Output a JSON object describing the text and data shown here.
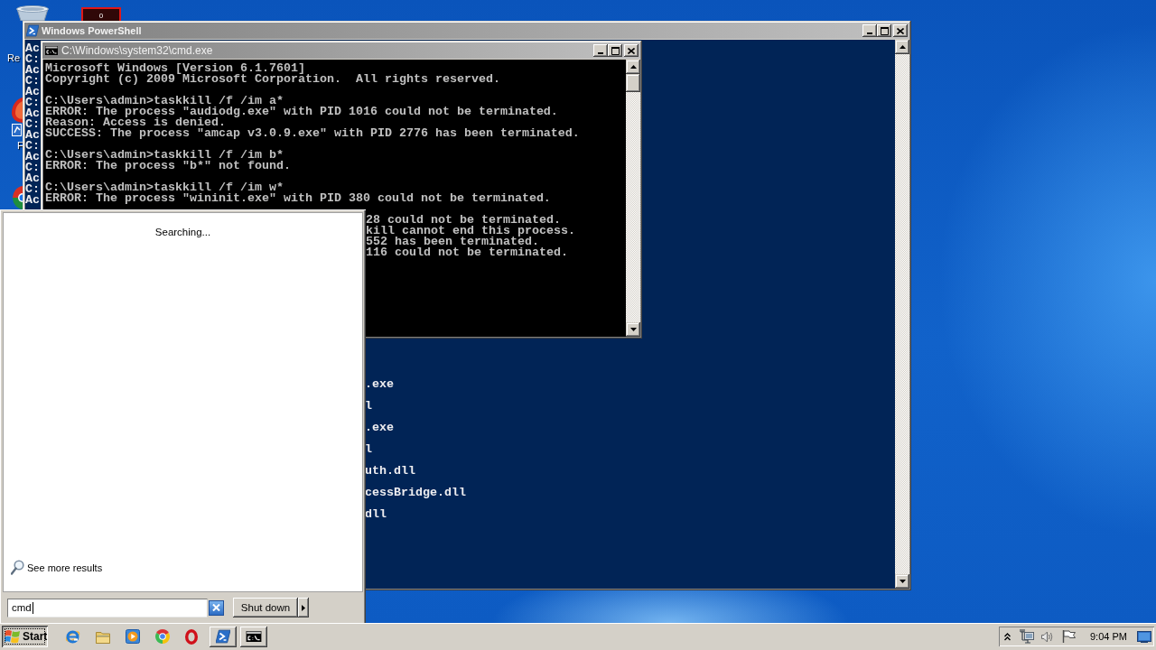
{
  "desktop": {
    "icons": [
      {
        "kind": "bin",
        "label": "Re"
      },
      {
        "kind": "counter",
        "text": "0"
      },
      {
        "kind": "shortcut",
        "label": "F"
      },
      {
        "kind": "round"
      }
    ]
  },
  "powershell": {
    "title": "Windows PowerShell",
    "left_fragments": [
      "Ac",
      "C:",
      "Ac",
      "C:",
      "Ac",
      "C:",
      "Ac",
      "C:",
      "Ac",
      "C:",
      "Ac",
      "C:",
      "Ac",
      "C:",
      "Ac"
    ],
    "right_fragments": [
      ".exe",
      "l",
      ".exe",
      "l",
      "uth.dll",
      "cessBridge.dll",
      "dll"
    ]
  },
  "cmd": {
    "title": "C:\\Windows\\system32\\cmd.exe",
    "blocks": [
      [
        "Microsoft Windows [Version 6.1.7601]",
        "Copyright (c) 2009 Microsoft Corporation.  All rights reserved."
      ],
      [
        "C:\\Users\\admin>taskkill /f /im a*",
        "ERROR: The process \"audiodg.exe\" with PID 1016 could not be terminated.",
        "Reason: Access is denied.",
        "SUCCESS: The process \"amcap v3.0.9.exe\" with PID 2776 has been terminated."
      ],
      [
        "C:\\Users\\admin>taskkill /f /im b*",
        "ERROR: The process \"b*\" not found."
      ],
      [
        "C:\\Users\\admin>taskkill /f /im w*",
        "ERROR: The process \"wininit.exe\" with PID 380 could not be terminated."
      ]
    ],
    "partial_lines": [
      "28 could not be terminated.",
      "kill cannot end this process.",
      "552 has been terminated.",
      "116 could not be terminated."
    ]
  },
  "start_menu": {
    "status": "Searching...",
    "more_results": "See more results",
    "search": {
      "value": "cmd"
    },
    "shutdown": "Shut down"
  },
  "taskbar": {
    "start": {
      "label": "Start",
      "pressed": true
    },
    "quick_launch": [
      {
        "kind": "e-logo"
      },
      {
        "kind": "folder"
      },
      {
        "kind": "play"
      },
      {
        "kind": "pinwheel"
      },
      {
        "kind": "ring"
      }
    ],
    "tasks": [
      {
        "kind": "prompt"
      },
      {
        "kind": "console"
      }
    ],
    "clock": "9:04 PM"
  }
}
